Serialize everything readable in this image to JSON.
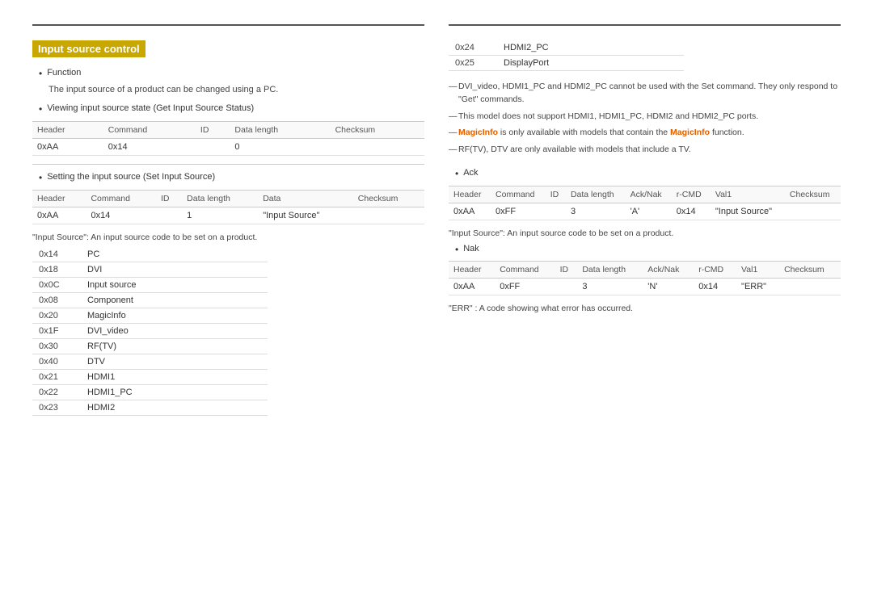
{
  "page": {
    "title": "Input source control",
    "top_line_visible": true
  },
  "left": {
    "section_title": "Input source control",
    "function_bullet": "Function",
    "function_desc": "The input source of a product can be changed using a PC.",
    "viewing_bullet": "Viewing input source state (Get Input Source Status)",
    "get_table": {
      "headers": [
        "Header",
        "Command",
        "ID",
        "Data length",
        "Checksum"
      ],
      "rows": [
        [
          "0xAA",
          "0x14",
          "",
          "0",
          ""
        ]
      ]
    },
    "setting_bullet": "Setting the input source (Set Input Source)",
    "set_table": {
      "headers": [
        "Header",
        "Command",
        "ID",
        "Data length",
        "Data",
        "Checksum"
      ],
      "rows": [
        [
          "0xAA",
          "0x14",
          "",
          "1",
          "\"Input Source\"",
          ""
        ]
      ]
    },
    "source_note": "\"Input Source\": An input source code to be set on a product.",
    "sources": [
      {
        "code": "0x14",
        "name": "PC"
      },
      {
        "code": "0x18",
        "name": "DVI"
      },
      {
        "code": "0x0C",
        "name": "Input source"
      },
      {
        "code": "0x08",
        "name": "Component"
      },
      {
        "code": "0x20",
        "name": "MagicInfo"
      },
      {
        "code": "0x1F",
        "name": "DVI_video"
      },
      {
        "code": "0x30",
        "name": "RF(TV)"
      },
      {
        "code": "0x40",
        "name": "DTV"
      },
      {
        "code": "0x21",
        "name": "HDMI1"
      },
      {
        "code": "0x22",
        "name": "HDMI1_PC"
      },
      {
        "code": "0x23",
        "name": "HDMI2"
      }
    ]
  },
  "right": {
    "sources_continued": [
      {
        "code": "0x24",
        "name": "HDMI2_PC"
      },
      {
        "code": "0x25",
        "name": "DisplayPort"
      }
    ],
    "notes": [
      "DVI_video, HDMI1_PC and HDMI2_PC cannot be used with the Set command. They only respond to \"Get\" commands.",
      "This model does not support HDMI1, HDMI1_PC, HDMI2 and HDMI2_PC ports."
    ],
    "magicinfo_note_prefix": "MagicInfo",
    "magicinfo_note_mid": " is only available with models that contain the ",
    "magicinfo_note_bold": "MagicInfo",
    "magicinfo_note_suffix": " function.",
    "rftv_note": "RF(TV), DTV are only available with models that include a TV.",
    "ack_bullet": "Ack",
    "ack_table": {
      "headers": [
        "Header",
        "Command",
        "ID",
        "Data length",
        "Ack/Nak",
        "r-CMD",
        "Val1",
        "Checksum"
      ],
      "rows": [
        [
          "0xAA",
          "0xFF",
          "",
          "3",
          "'A'",
          "0x14",
          "\"Input Source\"",
          ""
        ]
      ]
    },
    "ack_source_note": "\"Input Source\": An input source code to be set on a product.",
    "nak_bullet": "Nak",
    "nak_table": {
      "headers": [
        "Header",
        "Command",
        "ID",
        "Data length",
        "Ack/Nak",
        "r-CMD",
        "Val1",
        "Checksum"
      ],
      "rows": [
        [
          "0xAA",
          "0xFF",
          "",
          "3",
          "'N'",
          "0x14",
          "\"ERR\"",
          ""
        ]
      ]
    },
    "err_note": "\"ERR\" : A code showing what error has occurred."
  }
}
